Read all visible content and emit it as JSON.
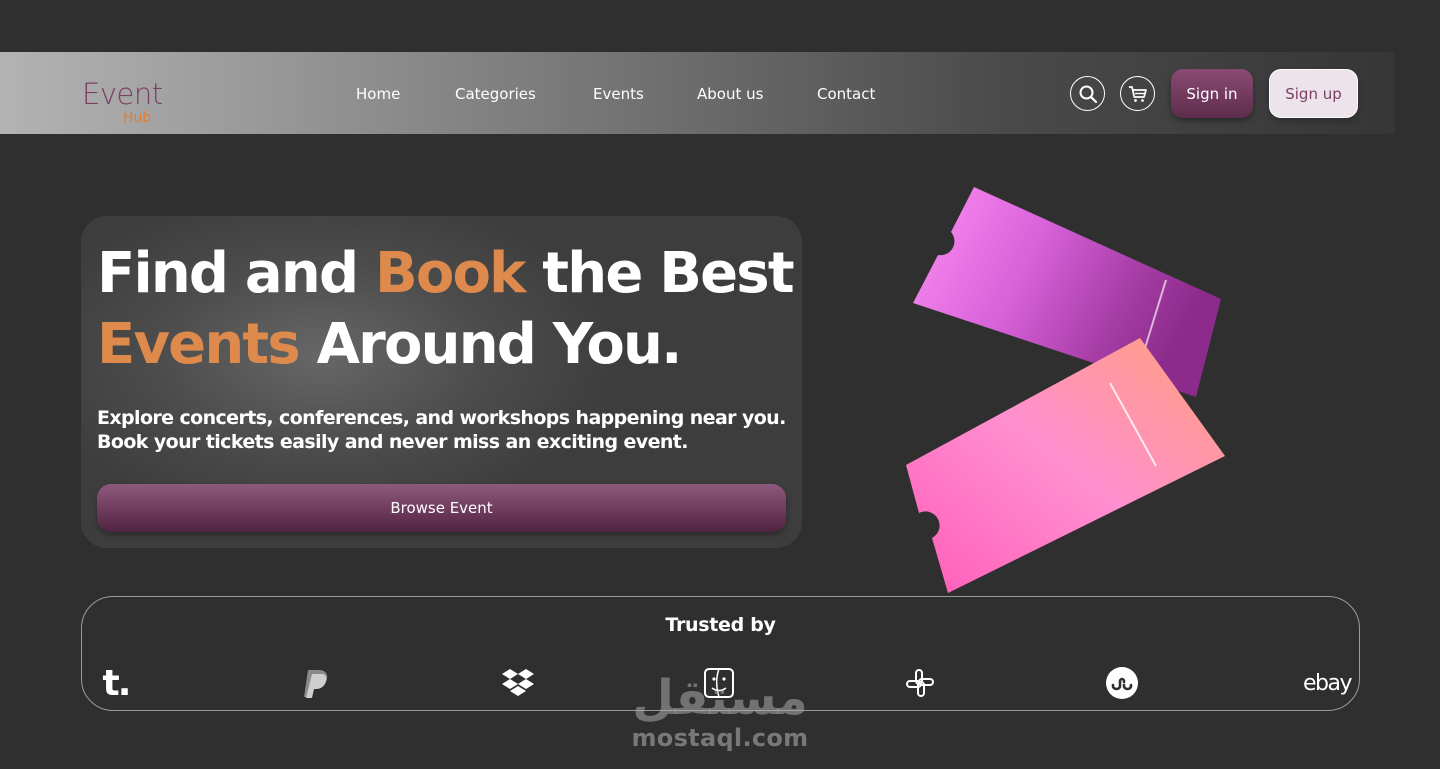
{
  "brand": {
    "name": "Event",
    "sub": "Hub",
    "color": "#7a3f63",
    "sub_color": "#e07d36"
  },
  "nav": {
    "links": [
      "Home",
      "Categories",
      "Events",
      "About us",
      "Contact"
    ],
    "search_icon": "search-icon",
    "cart_icon": "cart-icon",
    "signin_label": "Sign in",
    "signup_label": "Sign up"
  },
  "hero": {
    "title_part1": "Find and ",
    "title_accent1": "Book",
    "title_part2": " the Best",
    "title_accent2": "Events",
    "title_part3": " Around You.",
    "subtitle_line1": "Explore concerts, conferences, and workshops happening near you.",
    "subtitle_line2": "Book your tickets easily and never miss an exciting event.",
    "cta_label": "Browse Event",
    "accent_color": "#dd8a4c"
  },
  "trusted": {
    "title": "Trusted by",
    "logos": [
      "tumblr-logo",
      "paypal-logo",
      "dropbox-logo",
      "finder-logo",
      "slack-logo",
      "stumbleupon-logo",
      "ebay-logo"
    ],
    "tumblr_text": "t.",
    "ebay_text": "ebay"
  },
  "watermark": {
    "arabic": "مستقل",
    "latin": "mostaql.com"
  }
}
